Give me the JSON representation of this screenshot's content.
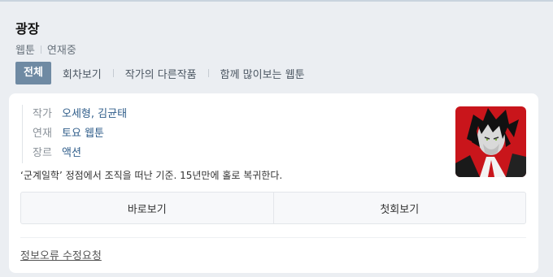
{
  "title": "광장",
  "meta": {
    "type": "웹툰",
    "status": "연재중"
  },
  "tabs": [
    {
      "label": "전체"
    },
    {
      "label": "회차보기"
    },
    {
      "label": "작가의 다른작품"
    },
    {
      "label": "함께 많이보는 웹툰"
    }
  ],
  "info": {
    "author_label": "작가",
    "author_value": "오세형, 김균태",
    "schedule_label": "연재",
    "schedule_value": "토요 웹툰",
    "genre_label": "장르",
    "genre_value": "액션"
  },
  "description": "‘군계일학’ 정점에서 조직을 떠난 기준. 15년만에 홀로 복귀한다.",
  "buttons": {
    "read_now": "바로보기",
    "first_episode": "첫회보기"
  },
  "report_link": "정보오류 수정요청",
  "colors": {
    "active_tab": "#6f8aa3",
    "link": "#2f5d8a",
    "thumbnail_bg": "#c9151b"
  }
}
